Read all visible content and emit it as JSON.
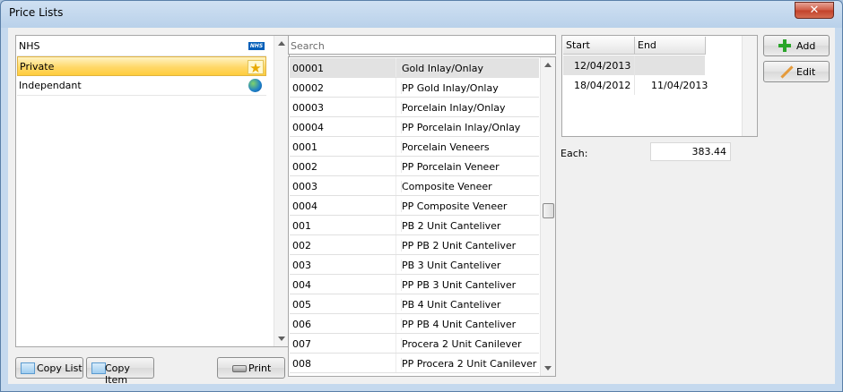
{
  "window": {
    "title": "Price Lists",
    "close_glyph": "✕"
  },
  "price_lists": [
    {
      "label": "NHS",
      "icon": "nhs-logo-icon"
    },
    {
      "label": "Private",
      "icon": "star-icon",
      "selected": true
    },
    {
      "label": "Independant",
      "icon": "globe-icon"
    }
  ],
  "icons": {
    "nhs_text": "NHS",
    "star_glyph": "★"
  },
  "buttons": {
    "copy_list": "Copy List",
    "copy_item": "Copy Item",
    "print": "Print",
    "add": "Add",
    "edit": "Edit"
  },
  "search": {
    "placeholder": "Search"
  },
  "items": [
    {
      "code": "00001",
      "desc": "Gold Inlay/Onlay"
    },
    {
      "code": "00002",
      "desc": "PP Gold Inlay/Onlay"
    },
    {
      "code": "00003",
      "desc": "Porcelain Inlay/Onlay"
    },
    {
      "code": "00004",
      "desc": "PP Porcelain Inlay/Onlay"
    },
    {
      "code": "0001",
      "desc": "Porcelain Veneers"
    },
    {
      "code": "0002",
      "desc": "PP Porcelain Veneer"
    },
    {
      "code": "0003",
      "desc": "Composite Veneer"
    },
    {
      "code": "0004",
      "desc": "PP Composite Veneer"
    },
    {
      "code": "001",
      "desc": "PB 2 Unit Canteliver"
    },
    {
      "code": "002",
      "desc": "PP PB 2 Unit Canteliver"
    },
    {
      "code": "003",
      "desc": "PB 3 Unit Canteliver"
    },
    {
      "code": "004",
      "desc": "PP PB 3 Unit Canteliver"
    },
    {
      "code": "005",
      "desc": "PB 4 Unit Canteliver"
    },
    {
      "code": "006",
      "desc": "PP PB 4 Unit Canteliver"
    },
    {
      "code": "007",
      "desc": "Procera 2 Unit Canilever"
    },
    {
      "code": "008",
      "desc": "PP Procera 2 Unit Canilever"
    }
  ],
  "dates": {
    "headers": [
      "Start",
      "End"
    ],
    "rows": [
      {
        "start": "12/04/2013",
        "end": ""
      },
      {
        "start": "18/04/2012",
        "end": "11/04/2013"
      }
    ]
  },
  "each": {
    "label": "Each:",
    "value": "383.44"
  }
}
